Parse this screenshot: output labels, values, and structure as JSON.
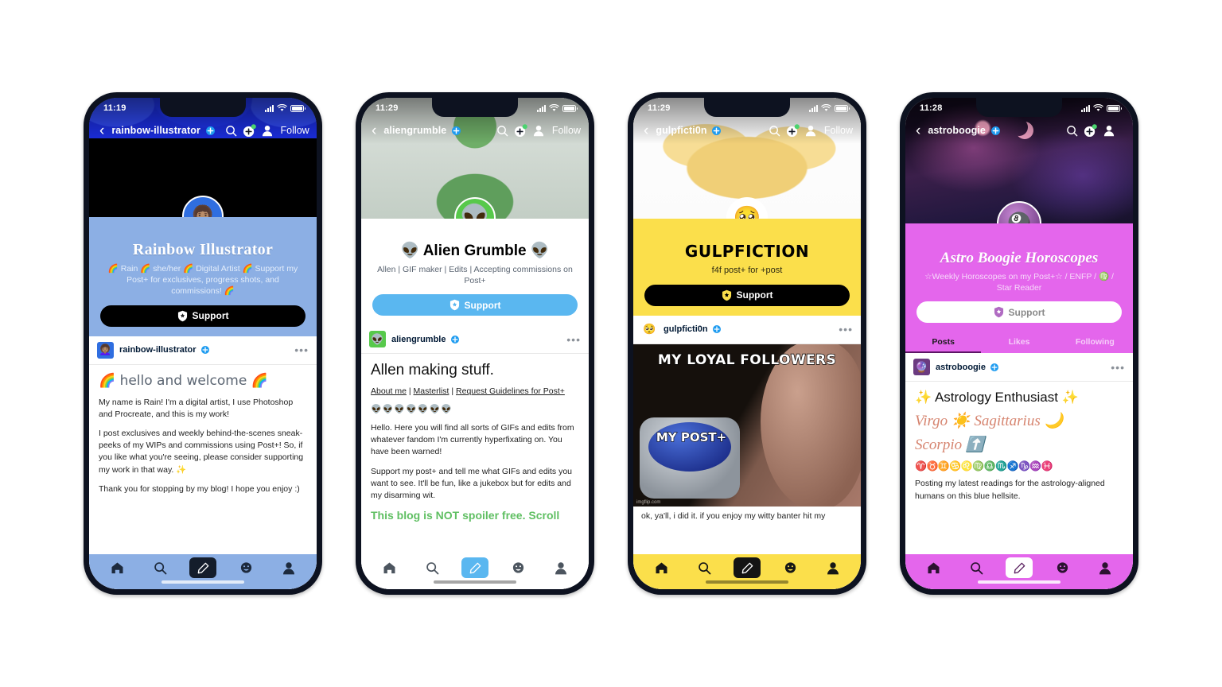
{
  "phones": [
    {
      "id": "rainbow-illustrator",
      "status": {
        "time": "11:19",
        "signal": "signal-bars-icon",
        "wifi": "wifi-icon",
        "battery": "battery-icon"
      },
      "topnav": {
        "back": "‹",
        "username": "rainbow-illustrator",
        "verified": true,
        "search": "search-icon",
        "create": "create-post-icon",
        "account": "account-icon",
        "follow": "Follow"
      },
      "avatar_emoji": "👩🏽‍🦱",
      "profile": {
        "title": "Rainbow Illustrator",
        "description": "🌈 Rain 🌈 she/her 🌈 Digital Artist 🌈 Support my Post+ for exclusives, progress shots, and commissions! 🌈",
        "support_label": "Support"
      },
      "post": {
        "avatar_emoji": "👩🏽‍🦱",
        "author": "rainbow-illustrator",
        "menu": "•••",
        "heading": "🌈 hello and welcome 🌈",
        "paragraphs": [
          "My name is Rain! I'm a digital artist, I use Photoshop and Procreate, and this is my work!",
          "I post exclusives and weekly behind-the-scenes sneak-peeks of my WIPs and commissions using Post+! So, if you like what you're seeing, please consider supporting my work in that way. ✨",
          "Thank you for stopping by my blog! I hope you enjoy :)"
        ]
      },
      "nav": [
        "home-icon",
        "search-icon",
        "compose-icon",
        "messages-icon",
        "account-icon"
      ]
    },
    {
      "id": "aliengrumble",
      "status": {
        "time": "11:29"
      },
      "topnav": {
        "back": "‹",
        "username": "aliengrumble",
        "verified": true,
        "follow": "Follow"
      },
      "avatar_emoji": "👽",
      "profile": {
        "title": "👽 Alien Grumble 👽",
        "description": "Allen | GIF maker | Edits | Accepting commissions on Post+",
        "support_label": "Support"
      },
      "post": {
        "avatar_emoji": "👽",
        "author": "aliengrumble",
        "menu": "•••",
        "heading": "Allen making stuff.",
        "links": [
          "About me",
          "Masterlist",
          "Request Guidelines for Post+"
        ],
        "link_sep": " | ",
        "emoji_row": "👽👽👽👽👽👽👽",
        "paragraphs": [
          "Hello. Here you will find all sorts of GIFs and edits from whatever fandom I'm currently hyperfixating on. You have been warned!",
          "Support my post+ and tell me what GIFs and edits you want to see. It'll be fun, like a jukebox but for edits and my disarming wit."
        ],
        "highlight": "This blog is NOT spoiler free. Scroll"
      }
    },
    {
      "id": "gulpficti0n",
      "status": {
        "time": "11:29"
      },
      "topnav": {
        "back": "‹",
        "username": "gulpficti0n",
        "verified": true,
        "follow": "Follow"
      },
      "avatar_emoji": "🥺",
      "profile": {
        "title": "GULPFICTION",
        "description": "f4f post+ for +post",
        "support_label": "Support"
      },
      "post": {
        "avatar_emoji": "🥺",
        "author": "gulpficti0n",
        "menu": "•••",
        "meme_top": "MY LOYAL FOLLOWERS",
        "meme_button": "MY POST+",
        "meme_watermark": "imgflip.com",
        "caption": "ok, ya'll, i did it. if you enjoy my witty banter hit my"
      }
    },
    {
      "id": "astroboogie",
      "status": {
        "time": "11:28"
      },
      "topnav": {
        "back": "‹",
        "username": "astroboogie",
        "verified": true,
        "follow": ""
      },
      "avatar_emoji": "🎱",
      "profile": {
        "title": "Astro Boogie Horoscopes",
        "description": "☆Weekly Horoscopes on my Post+☆ / ENFP / ♍ / Star Reader",
        "support_label": "Support"
      },
      "tabs": [
        {
          "label": "Posts",
          "active": true
        },
        {
          "label": "Likes",
          "active": false
        },
        {
          "label": "Following",
          "active": false
        }
      ],
      "post": {
        "avatar_emoji": "🔮",
        "author": "astroboogie",
        "menu": "•••",
        "heading": "✨ Astrology Enthusiast ✨",
        "script_line_1": "Virgo ☀️ Sagittarius 🌙",
        "script_line_2": "Scorpio ⬆️",
        "zodiac_row": "♈♉♊♋♌♍♎♏♐♑♒♓",
        "paragraph": "Posting my latest readings for the astrology-aligned humans on this blue hellsite."
      }
    }
  ],
  "colors": {
    "phone1_panel": "#8cafe4",
    "phone3_panel": "#fbdf4b",
    "phone4_panel": "#e466ec",
    "accent_blue": "#5ab7f0",
    "accent_green": "#5fbf62",
    "verified_blue": "#1d9bf0"
  }
}
